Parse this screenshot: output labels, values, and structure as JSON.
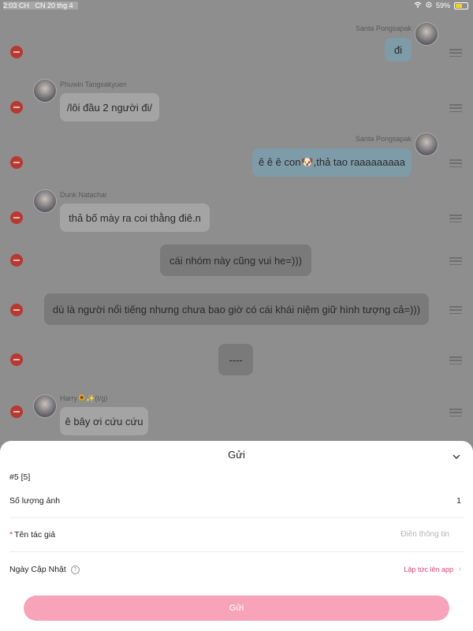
{
  "status_bar": {
    "time": "2:03 CH",
    "date": "CN 20 thg 4",
    "battery": "59%",
    "battery_level": 0.59,
    "wifi_icon": "wifi-icon",
    "location_icon": "location-icon"
  },
  "colors": {
    "accent": "#f7a3ba",
    "link": "#e0457a",
    "delete": "#b73a32"
  },
  "chat": {
    "messages": [
      {
        "sender": "Santa Pongsapak",
        "text": "đi",
        "side": "right"
      },
      {
        "sender": "Phuwin Tangsakyuen",
        "text": "/lôi đầu 2 người đi/",
        "side": "left"
      },
      {
        "sender": "Santa Pongsapak",
        "text": "ê ê ê con🐶,thả tao raaaaaaaaa",
        "side": "right"
      },
      {
        "sender": "Dunk Natachai",
        "text": "thả bố mày ra coi thằng điê.n",
        "side": "left"
      },
      {
        "sender": "",
        "text": "cái nhóm này cũng vui he=)))",
        "side": "center"
      },
      {
        "sender": "",
        "text": "dù là người nổi tiếng nhưng chưa bao giờ có cái khái niệm giữ hình tượng cả=)))",
        "side": "center"
      },
      {
        "sender": "",
        "text": "----",
        "side": "center"
      },
      {
        "sender": "Harry🌻✨(t/g)",
        "text": "ê bây ơi cứu cứu",
        "side": "left"
      }
    ]
  },
  "sheet": {
    "title": "Gửi",
    "id_line": "#5 [5]",
    "image_count_label": "Số lượng ảnh",
    "image_count_value": "1",
    "author_label": "Tên tác giả",
    "author_placeholder": "Điền thông tin",
    "update_label": "Ngày Cập Nhật",
    "update_value": "Lập tức lên app",
    "send_button": "Gửi"
  }
}
